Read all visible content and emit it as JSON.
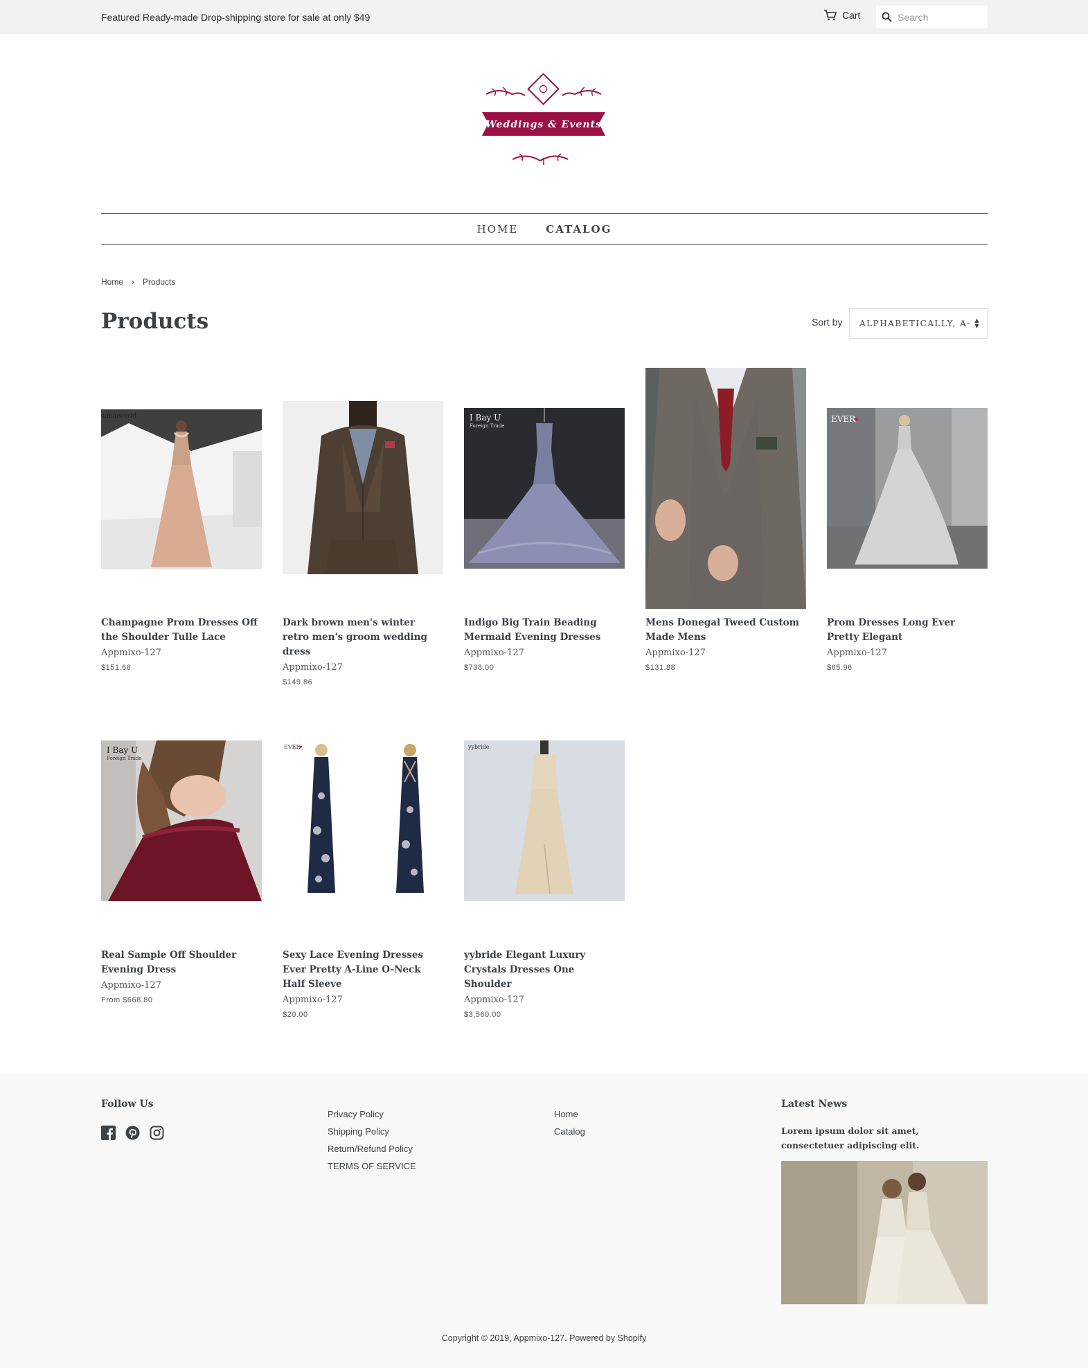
{
  "topbar": {
    "promo_text": "Featured Ready-made Drop-shipping store for sale at only $49",
    "cart_label": "Cart",
    "search_placeholder": "Search"
  },
  "logo": {
    "text": "Weddings & Events",
    "brand_color": "#9b1145"
  },
  "nav": {
    "items": [
      {
        "label": "HOME"
      },
      {
        "label": "CATALOG"
      }
    ]
  },
  "breadcrumb": {
    "home": "Home",
    "separator": "›",
    "current": "Products"
  },
  "page": {
    "title": "Products",
    "sort_label": "Sort by",
    "sort_value": "ALPHABETICALLY, A-"
  },
  "products": [
    {
      "name": "Champagne Prom Dresses Off the Shoulder Tulle Lace",
      "vendor": "Appmixo-127",
      "price": "$151.68"
    },
    {
      "name": "Dark brown men's winter retro men's groom wedding dress",
      "vendor": "Appmixo-127",
      "price": "$149.86"
    },
    {
      "name": "Indigo Big Train Beading Mermaid Evening Dresses",
      "vendor": "Appmixo-127",
      "price": "$738.00"
    },
    {
      "name": "Mens Donegal Tweed Custom Made Mens",
      "vendor": "Appmixo-127",
      "price": "$131.88"
    },
    {
      "name": "Prom Dresses Long Ever Pretty Elegant",
      "vendor": "Appmixo-127",
      "price": "$65.96"
    },
    {
      "name": "Real Sample Off Shoulder Evening Dress",
      "vendor": "Appmixo-127",
      "price": "From $668.80"
    },
    {
      "name": "Sexy Lace Evening Dresses Ever Pretty A-Line O-Neck Half Sleeve",
      "vendor": "Appmixo-127",
      "price": "$20.00"
    },
    {
      "name": "yybride Elegant Luxury Crystals Dresses One Shoulder",
      "vendor": "Appmixo-127",
      "price": "$3,560.00"
    }
  ],
  "footer": {
    "follow_title": "Follow Us",
    "social": [
      "facebook-icon",
      "pinterest-icon",
      "instagram-icon"
    ],
    "policy_links": [
      "Privacy Policy",
      "Shipping Policy",
      "Return/Refund Policy",
      "TERMS OF SERVICE"
    ],
    "nav_links": [
      "Home",
      "Catalog"
    ],
    "news_title": "Latest News",
    "news_text": "Lorem ipsum dolor sit amet, consectetuer adipiscing elit.",
    "copyright": "Copyright © 2019, Appmixo-127. Powered by Shopify"
  }
}
